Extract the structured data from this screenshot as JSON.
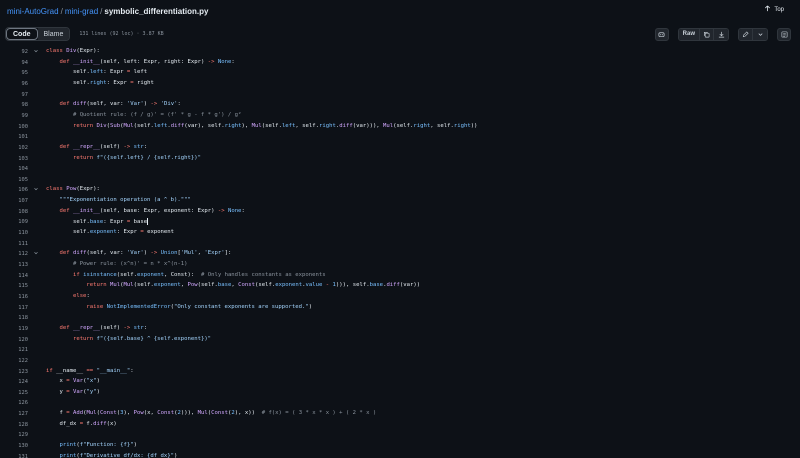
{
  "breadcrumb": {
    "repo": "mini-AutoGrad",
    "folder": "mini-grad",
    "separator": "/",
    "file": "symbolic_differentiation.py"
  },
  "top_link": "Top",
  "tabs": {
    "code": "Code",
    "blame": "Blame"
  },
  "file_meta": "131 lines (92 loc) · 3.87 KB",
  "raw_label": "Raw",
  "colors": {
    "keyword": "#ff7b72",
    "function": "#d2a8ff",
    "string": "#a5d6ff",
    "number": "#79c0ff",
    "builtin": "#ffa657",
    "comment": "#8b949e",
    "accent_link": "#4493f8"
  },
  "icons": {
    "top": "arrow-up-icon",
    "copilot": "copilot-icon",
    "copy": "copy-icon",
    "download": "download-icon",
    "edit": "pencil-icon",
    "more": "chevron-down-icon",
    "panel": "symbols-panel-icon"
  },
  "lines": [
    {
      "n": "92",
      "fold": true,
      "code": "class Div(Expr):"
    },
    {
      "n": "94",
      "fold": false,
      "code": "    def __init__(self, left: Expr, right: Expr) -> None:"
    },
    {
      "n": "95",
      "fold": false,
      "code": "        self.left: Expr = left"
    },
    {
      "n": "96",
      "fold": false,
      "code": "        self.right: Expr = right"
    },
    {
      "n": "97",
      "fold": false,
      "code": ""
    },
    {
      "n": "98",
      "fold": false,
      "code": "    def diff(self, var: 'Var') -> 'Div':"
    },
    {
      "n": "99",
      "fold": false,
      "code": "        # Quotient rule: (f / g)' = (f' * g - f * g') / g²"
    },
    {
      "n": "100",
      "fold": false,
      "code": "        return Div(Sub(Mul(self.left.diff(var), self.right), Mul(self.left, self.right.diff(var))), Mul(self.right, self.right))"
    },
    {
      "n": "101",
      "fold": false,
      "code": ""
    },
    {
      "n": "102",
      "fold": false,
      "code": "    def __repr__(self) -> str:"
    },
    {
      "n": "103",
      "fold": false,
      "code": "        return f\"({self.left} / {self.right})\""
    },
    {
      "n": "104",
      "fold": false,
      "code": ""
    },
    {
      "n": "105",
      "fold": false,
      "code": ""
    },
    {
      "n": "106",
      "fold": true,
      "code": "class Pow(Expr):"
    },
    {
      "n": "107",
      "fold": false,
      "code": "    \"\"\"Exponentiation operation (a ^ b).\"\"\""
    },
    {
      "n": "108",
      "fold": false,
      "code": "    def __init__(self, base: Expr, exponent: Expr) -> None:"
    },
    {
      "n": "109",
      "fold": false,
      "code": "        self.base: Expr = base",
      "caret": true
    },
    {
      "n": "110",
      "fold": false,
      "code": "        self.exponent: Expr = exponent"
    },
    {
      "n": "111",
      "fold": false,
      "code": ""
    },
    {
      "n": "112",
      "fold": true,
      "code": "    def diff(self, var: 'Var') -> Union['Mul', 'Expr']:"
    },
    {
      "n": "113",
      "fold": false,
      "code": "        # Power rule: (x^n)' = n * x^(n-1)"
    },
    {
      "n": "114",
      "fold": false,
      "code": "        if isinstance(self.exponent, Const):  # Only handles constants as exponents"
    },
    {
      "n": "115",
      "fold": false,
      "code": "            return Mul(Mul(self.exponent, Pow(self.base, Const(self.exponent.value - 1))), self.base.diff(var))"
    },
    {
      "n": "116",
      "fold": false,
      "code": "        else:"
    },
    {
      "n": "117",
      "fold": false,
      "code": "            raise NotImplementedError(\"Only constant exponents are supported.\")"
    },
    {
      "n": "118",
      "fold": false,
      "code": ""
    },
    {
      "n": "119",
      "fold": false,
      "code": "    def __repr__(self) -> str:"
    },
    {
      "n": "120",
      "fold": false,
      "code": "        return f\"({self.base} ^ {self.exponent})\""
    },
    {
      "n": "121",
      "fold": false,
      "code": ""
    },
    {
      "n": "122",
      "fold": false,
      "code": ""
    },
    {
      "n": "123",
      "fold": false,
      "code": "if __name__ == \"__main__\":"
    },
    {
      "n": "124",
      "fold": false,
      "code": "    x = Var(\"x\")"
    },
    {
      "n": "125",
      "fold": false,
      "code": "    y = Var(\"y\")"
    },
    {
      "n": "126",
      "fold": false,
      "code": ""
    },
    {
      "n": "127",
      "fold": false,
      "code": "    f = Add(Mul(Const(3), Pow(x, Const(2))), Mul(Const(2), x))  # f(x) = ( 3 * x * x ) + ( 2 * x )"
    },
    {
      "n": "128",
      "fold": false,
      "code": "    df_dx = f.diff(x)"
    },
    {
      "n": "129",
      "fold": false,
      "code": ""
    },
    {
      "n": "130",
      "fold": false,
      "code": "    print(f\"Function: {f}\")"
    },
    {
      "n": "131",
      "fold": false,
      "code": "    print(f\"Derivative df/dx: {df_dx}\")"
    }
  ]
}
